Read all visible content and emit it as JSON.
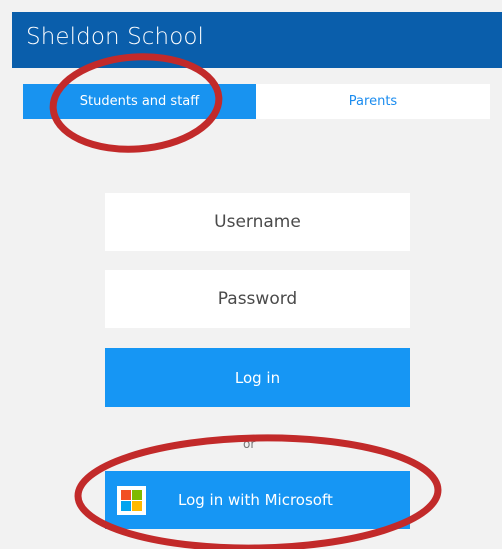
{
  "app_bar": {
    "title": "Sheldon School"
  },
  "tabs": [
    {
      "label": "Students and staff",
      "active": true
    },
    {
      "label": "Parents",
      "active": false
    }
  ],
  "form": {
    "username_placeholder": "Username",
    "password_placeholder": "Password",
    "login_label": "Log in",
    "or_label": "or",
    "microsoft_label": "Log in with Microsoft"
  },
  "icons": {
    "microsoft": "microsoft-logo-icon"
  },
  "colors": {
    "app_bar": "#0a5eab",
    "accent": "#1696f4",
    "annotation": "#c22a2a"
  }
}
